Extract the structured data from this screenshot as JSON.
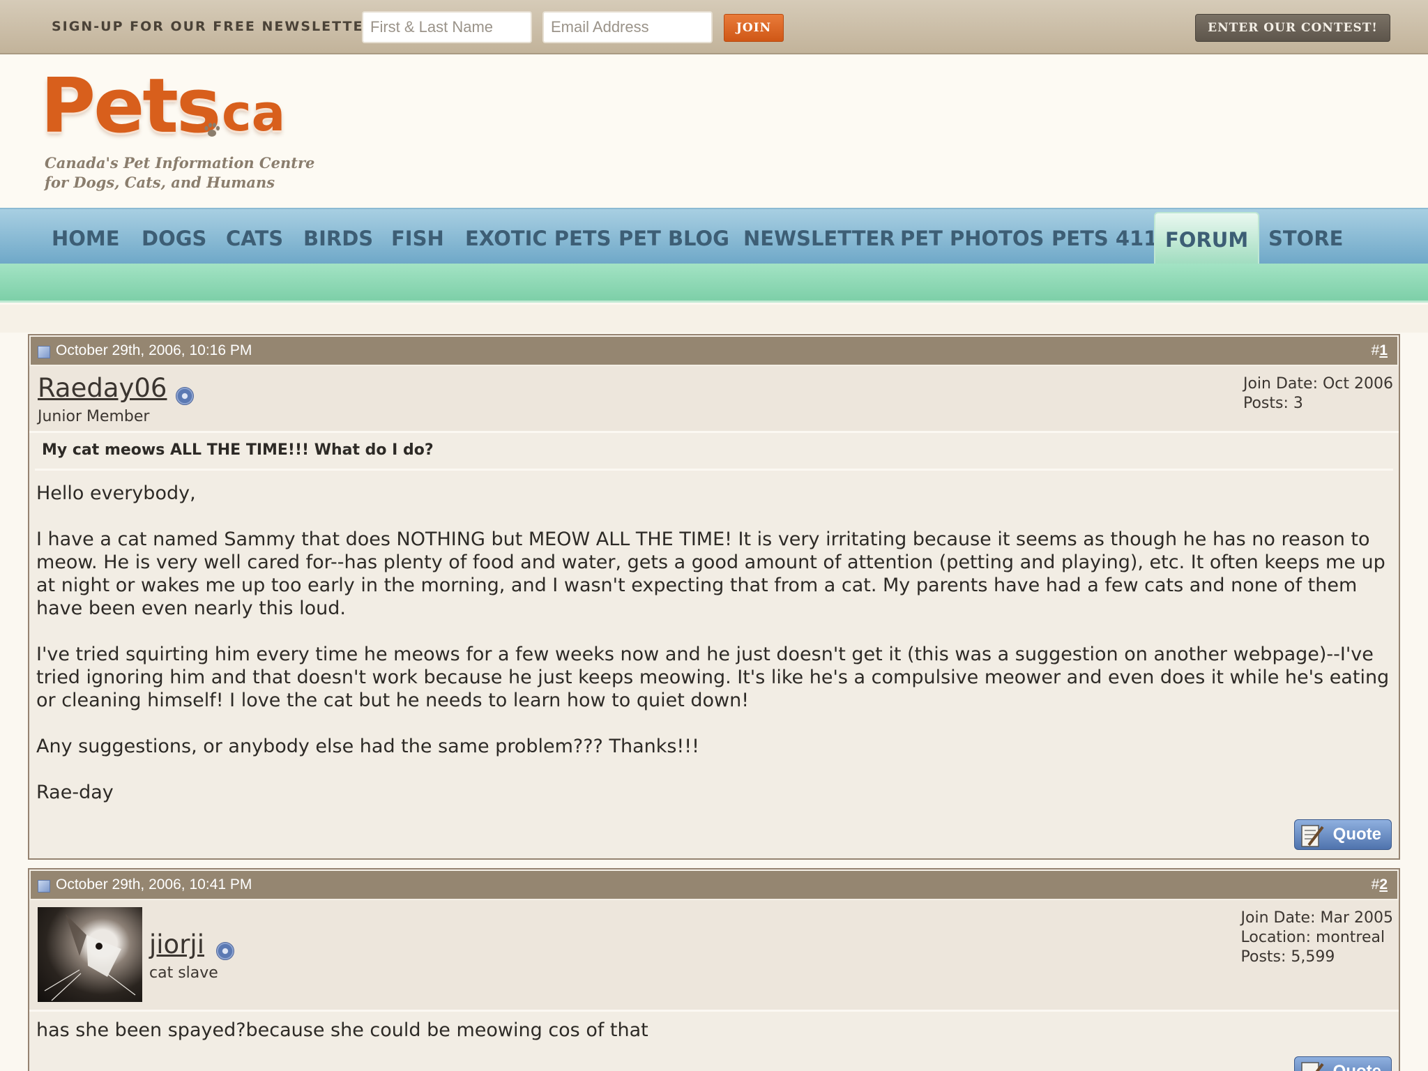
{
  "newsletter": {
    "label": "SIGN-UP FOR OUR FREE NEWSLETTER!",
    "name_placeholder": "First & Last Name",
    "email_placeholder": "Email Address",
    "join_label": "JOIN",
    "contest_label": "ENTER OUR CONTEST!"
  },
  "logo": {
    "name": "Pets",
    "tld": "ca",
    "tagline_line1": "Canada's Pet Information Centre",
    "tagline_line2": "for Dogs, Cats, and Humans"
  },
  "nav": {
    "items": [
      "HOME",
      "DOGS",
      "CATS",
      "BIRDS",
      "FISH",
      "EXOTIC PETS",
      "PET BLOG",
      "NEWSLETTER",
      "PET PHOTOS",
      "PETS 411",
      "FORUM",
      "STORE"
    ],
    "active": "FORUM"
  },
  "posts": [
    {
      "date": "October 29th, 2006, 10:16 PM",
      "hash": "#",
      "number": "1",
      "username": "Raeday06",
      "user_title": "Junior Member",
      "join_date": "Join Date: Oct 2006",
      "posts": "Posts: 3",
      "title": "My cat meows ALL THE TIME!!! What do I do?",
      "paragraphs": [
        "Hello everybody,",
        "I have a cat named Sammy that does NOTHING but MEOW ALL THE TIME! It is very irritating because it seems as though he has no reason to meow. He is very well cared for--has plenty of food and water, gets a good amount of attention (petting and playing), etc. It often keeps me up at night or wakes me up too early in the morning, and I wasn't expecting that from a cat. My parents have had a few cats and none of them have been even nearly this loud.",
        "I've tried squirting him every time he meows for a few weeks now and he just doesn't get it (this was a suggestion on another webpage)--I've tried ignoring him and that doesn't work because he just keeps meowing. It's like he's a compulsive meower and even does it while he's eating or cleaning himself! I love the cat but he needs to learn how to quiet down!",
        "Any suggestions, or anybody else had the same problem??? Thanks!!!",
        "Rae-day"
      ],
      "quote_label": "Quote"
    },
    {
      "date": "October 29th, 2006, 10:41 PM",
      "hash": "#",
      "number": "2",
      "username": "jiorji",
      "user_title": "cat slave",
      "join_date": "Join Date: Mar 2005",
      "location": "Location: montreal",
      "posts": "Posts: 5,599",
      "paragraphs": [
        "has she been spayed?because she could be meowing cos of that"
      ],
      "quote_label": "Quote"
    }
  ]
}
